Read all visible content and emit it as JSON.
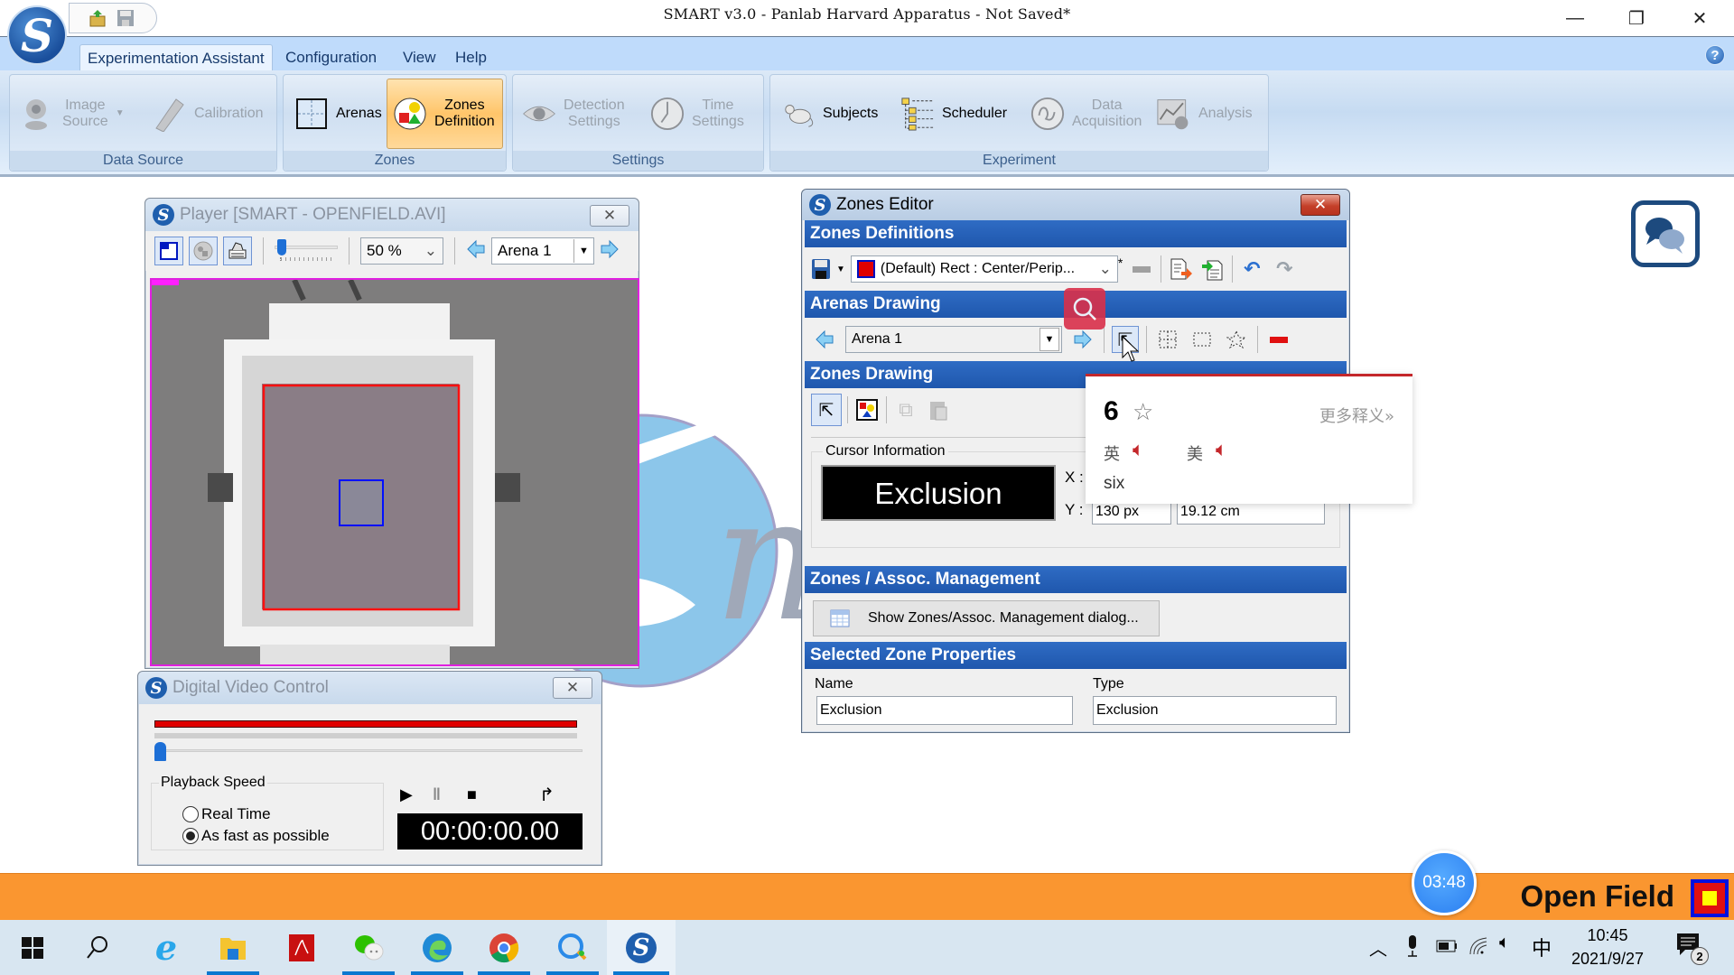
{
  "window": {
    "title": "SMART v3.0 - Panlab Harvard Apparatus - Not Saved*",
    "controls": {
      "minimize": "—",
      "restore": "❐",
      "close": "✕"
    }
  },
  "quick_access": {
    "open_icon": "open-folder-icon",
    "save_icon": "save-icon"
  },
  "menu": {
    "tabs": [
      "Experimentation Assistant",
      "Configuration",
      "View",
      "Help"
    ],
    "active": "Experimentation Assistant",
    "help_icon": "?"
  },
  "ribbon": {
    "groups": [
      {
        "label": "Data Source",
        "buttons": [
          {
            "label1": "Image",
            "label2": "Source",
            "enabled": false,
            "icon": "webcam-icon"
          },
          {
            "label1": "Calibration",
            "label2": "",
            "enabled": false,
            "icon": "ruler-icon"
          }
        ]
      },
      {
        "label": "Zones",
        "buttons": [
          {
            "label1": "Arenas",
            "label2": "",
            "enabled": true,
            "icon": "arena-icon"
          },
          {
            "label1": "Zones",
            "label2": "Definition",
            "enabled": true,
            "selected": true,
            "icon": "zones-icon"
          }
        ]
      },
      {
        "label": "Settings",
        "buttons": [
          {
            "label1": "Detection",
            "label2": "Settings",
            "enabled": false,
            "icon": "eye-icon"
          },
          {
            "label1": "Time",
            "label2": "Settings",
            "enabled": false,
            "icon": "clock-icon"
          }
        ]
      },
      {
        "label": "Experiment",
        "buttons": [
          {
            "label1": "Subjects",
            "label2": "",
            "enabled": true,
            "icon": "rat-icon"
          },
          {
            "label1": "Scheduler",
            "label2": "",
            "enabled": true,
            "icon": "scheduler-tree-icon"
          },
          {
            "label1": "Data",
            "label2": "Acquisition",
            "enabled": false,
            "icon": "acquisition-icon"
          },
          {
            "label1": "Analysis",
            "label2": "",
            "enabled": false,
            "icon": "analysis-chart-icon"
          }
        ]
      }
    ]
  },
  "player": {
    "title": "Player [SMART - OPENFIELD.AVI]",
    "zoom": "50 %",
    "arena": "Arena 1",
    "zoom_slider": 0.05
  },
  "dvc": {
    "title": "Digital Video Control",
    "position": 0.0,
    "playback_speed_label": "Playback Speed",
    "options": [
      "Real Time",
      "As fast as possible"
    ],
    "selected_option": "As fast as possible",
    "time": "00:00:00.00"
  },
  "zones_editor": {
    "title": "Zones Editor",
    "sections": {
      "definitions": "Zones Definitions",
      "arenas_drawing": "Arenas Drawing",
      "zones_drawing": "Zones Drawing",
      "management": "Zones / Assoc. Management",
      "properties": "Selected Zone Properties"
    },
    "definition_value": "(Default) Rect : Center/Perip...",
    "definition_modified": "*",
    "arena_value": "Arena 1",
    "cursor_info_label": "Cursor Information",
    "cursor_zone": "Exclusion",
    "x_label": "X :",
    "y_label": "Y :",
    "y_px": "130 px",
    "y_cm": "19.12 cm",
    "management_button": "Show Zones/Assoc. Management dialog...",
    "name_label": "Name",
    "name_value": "Exclusion",
    "type_label": "Type",
    "type_value": "Exclusion"
  },
  "dictionary_popup": {
    "word": "6",
    "more": "更多释义»",
    "uk_label": "英",
    "us_label": "美",
    "meaning": "six"
  },
  "status_bar": {
    "experiment": "Open Field",
    "recording_timer": "03:48"
  },
  "taskbar": {
    "apps": [
      "start-icon",
      "search-icon",
      "internet-explorer-icon",
      "file-explorer-icon",
      "acrobat-icon",
      "wechat-icon",
      "edge-icon",
      "chrome-icon",
      "qq-browser-icon",
      "smart-app-icon"
    ],
    "running": [
      false,
      false,
      false,
      true,
      false,
      true,
      true,
      true,
      true,
      true
    ],
    "tray": {
      "ime": "中",
      "time": "10:45",
      "date": "2021/9/27",
      "notifications": "2"
    }
  }
}
